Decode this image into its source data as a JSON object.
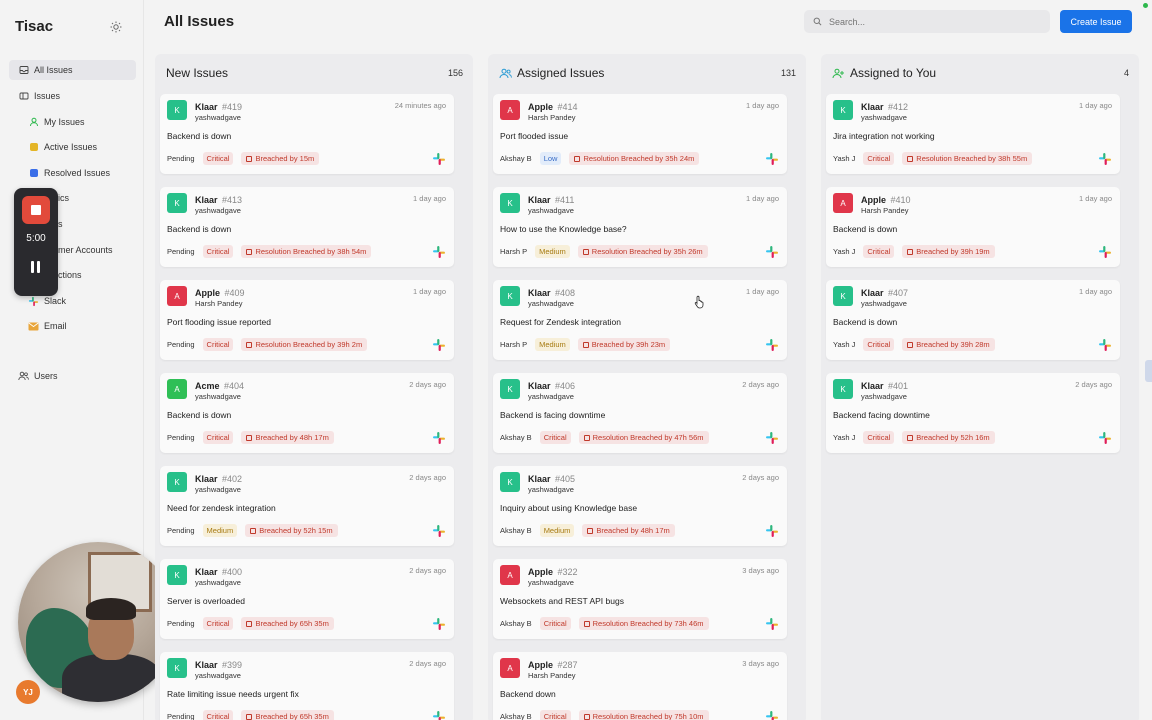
{
  "app": {
    "name": "Tisac"
  },
  "sidebar": {
    "all_issues": "All Issues",
    "issues": "Issues",
    "sub_items": [
      {
        "label": "My Issues",
        "color": "#2db84d"
      },
      {
        "label": "Active Issues",
        "color": "#e4b526"
      },
      {
        "label": "Resolved Issues",
        "color": "#3a6ee8"
      },
      {
        "label": "ics",
        "color": ""
      },
      {
        "label": "s",
        "color": ""
      },
      {
        "label": "mer Accounts",
        "color": ""
      },
      {
        "label": "ctions",
        "color": ""
      },
      {
        "label": "Slack",
        "color": ""
      },
      {
        "label": "Email",
        "color": "#e8a53a"
      }
    ],
    "users": "Users",
    "user_initials": "YJ"
  },
  "recorder": {
    "time": "5:00"
  },
  "header": {
    "title": "All Issues",
    "search_placeholder": "Search...",
    "create_button": "Create Issue"
  },
  "columns": [
    {
      "title": "New Issues",
      "count": "156",
      "cards": [
        {
          "company": "Klaar",
          "number": "#419",
          "reporter": "yashwadgave",
          "time": "24 minutes ago",
          "subject": "Backend is down",
          "who": "Pending",
          "priority": "Critical",
          "breach": "Breached by 15m",
          "avatar_letter": "K",
          "avatar_color": "#27c08a"
        },
        {
          "company": "Klaar",
          "number": "#413",
          "reporter": "yashwadgave",
          "time": "1 day ago",
          "subject": "Backend is down",
          "who": "Pending",
          "priority": "Critical",
          "breach": "Resolution Breached by 38h 54m",
          "avatar_letter": "K",
          "avatar_color": "#27c08a"
        },
        {
          "company": "Apple",
          "number": "#409",
          "reporter": "Harsh Pandey",
          "time": "1 day ago",
          "subject": "Port flooding issue reported",
          "who": "Pending",
          "priority": "Critical",
          "breach": "Resolution Breached by 39h 2m",
          "avatar_letter": "A",
          "avatar_color": "#e0364a"
        },
        {
          "company": "Acme",
          "number": "#404",
          "reporter": "yashwadgave",
          "time": "2 days ago",
          "subject": "Backend is down",
          "who": "Pending",
          "priority": "Critical",
          "breach": "Breached by 48h 17m",
          "avatar_letter": "A",
          "avatar_color": "#2fbf56"
        },
        {
          "company": "Klaar",
          "number": "#402",
          "reporter": "yashwadgave",
          "time": "2 days ago",
          "subject": "Need for zendesk integration",
          "who": "Pending",
          "priority": "Medium",
          "breach": "Breached by 52h 15m",
          "avatar_letter": "K",
          "avatar_color": "#27c08a"
        },
        {
          "company": "Klaar",
          "number": "#400",
          "reporter": "yashwadgave",
          "time": "2 days ago",
          "subject": "Server is overloaded",
          "who": "Pending",
          "priority": "Critical",
          "breach": "Breached by 65h 35m",
          "avatar_letter": "K",
          "avatar_color": "#27c08a"
        },
        {
          "company": "Klaar",
          "number": "#399",
          "reporter": "yashwadgave",
          "time": "2 days ago",
          "subject": "Rate limiting issue needs urgent fix",
          "who": "Pending",
          "priority": "Critical",
          "breach": "Breached by 65h 35m",
          "avatar_letter": "K",
          "avatar_color": "#27c08a"
        }
      ]
    },
    {
      "title": "Assigned Issues",
      "count": "131",
      "cards": [
        {
          "company": "Apple",
          "number": "#414",
          "reporter": "Harsh Pandey",
          "time": "1 day ago",
          "subject": "Port flooded issue",
          "who": "Akshay B",
          "priority": "Low",
          "breach": "Resolution Breached by 35h 24m",
          "avatar_letter": "A",
          "avatar_color": "#e0364a"
        },
        {
          "company": "Klaar",
          "number": "#411",
          "reporter": "yashwadgave",
          "time": "1 day ago",
          "subject": "How to use the Knowledge base?",
          "who": "Harsh P",
          "priority": "Medium",
          "breach": "Resolution Breached by 35h 26m",
          "avatar_letter": "K",
          "avatar_color": "#27c08a"
        },
        {
          "company": "Klaar",
          "number": "#408",
          "reporter": "yashwadgave",
          "time": "1 day ago",
          "subject": "Request for Zendesk integration",
          "who": "Harsh P",
          "priority": "Medium",
          "breach": "Breached by 39h 23m",
          "avatar_letter": "K",
          "avatar_color": "#27c08a"
        },
        {
          "company": "Klaar",
          "number": "#406",
          "reporter": "yashwadgave",
          "time": "2 days ago",
          "subject": "Backend is facing downtime",
          "who": "Akshay B",
          "priority": "Critical",
          "breach": "Resolution Breached by 47h 56m",
          "avatar_letter": "K",
          "avatar_color": "#27c08a"
        },
        {
          "company": "Klaar",
          "number": "#405",
          "reporter": "yashwadgave",
          "time": "2 days ago",
          "subject": "Inquiry about using Knowledge base",
          "who": "Akshay B",
          "priority": "Medium",
          "breach": "Breached by 48h 17m",
          "avatar_letter": "K",
          "avatar_color": "#27c08a"
        },
        {
          "company": "Apple",
          "number": "#322",
          "reporter": "yashwadgave",
          "time": "3 days ago",
          "subject": "Websockets and REST API bugs",
          "who": "Akshay B",
          "priority": "Critical",
          "breach": "Resolution Breached by 73h 46m",
          "avatar_letter": "A",
          "avatar_color": "#e0364a"
        },
        {
          "company": "Apple",
          "number": "#287",
          "reporter": "Harsh Pandey",
          "time": "3 days ago",
          "subject": "Backend down",
          "who": "Akshay B",
          "priority": "Critical",
          "breach": "Resolution Breached by 75h 10m",
          "avatar_letter": "A",
          "avatar_color": "#e0364a"
        }
      ]
    },
    {
      "title": "Assigned to You",
      "count": "4",
      "cards": [
        {
          "company": "Klaar",
          "number": "#412",
          "reporter": "yashwadgave",
          "time": "1 day ago",
          "subject": "Jira integration not working",
          "who": "Yash J",
          "priority": "Critical",
          "breach": "Resolution Breached by 38h 55m",
          "avatar_letter": "K",
          "avatar_color": "#27c08a"
        },
        {
          "company": "Apple",
          "number": "#410",
          "reporter": "Harsh Pandey",
          "time": "1 day ago",
          "subject": "Backend is down",
          "who": "Yash J",
          "priority": "Critical",
          "breach": "Breached by 39h 19m",
          "avatar_letter": "A",
          "avatar_color": "#e0364a"
        },
        {
          "company": "Klaar",
          "number": "#407",
          "reporter": "yashwadgave",
          "time": "1 day ago",
          "subject": "Backend is down",
          "who": "Yash J",
          "priority": "Critical",
          "breach": "Breached by 39h 28m",
          "avatar_letter": "K",
          "avatar_color": "#27c08a"
        },
        {
          "company": "Klaar",
          "number": "#401",
          "reporter": "yashwadgave",
          "time": "2 days ago",
          "subject": "Backend facing downtime",
          "who": "Yash J",
          "priority": "Critical",
          "breach": "Breached by 52h 16m",
          "avatar_letter": "K",
          "avatar_color": "#27c08a"
        }
      ]
    }
  ]
}
